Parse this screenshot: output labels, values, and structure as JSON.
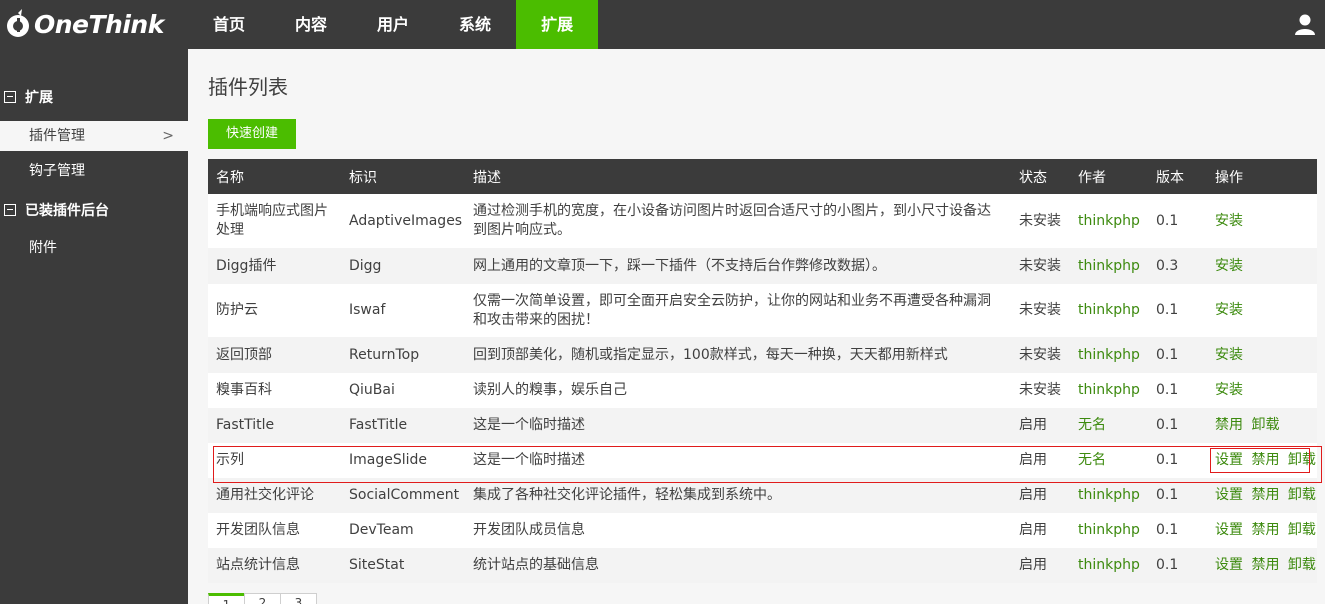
{
  "brand": {
    "name": "OneThink"
  },
  "topnav": [
    {
      "label": "首页",
      "active": false
    },
    {
      "label": "内容",
      "active": false
    },
    {
      "label": "用户",
      "active": false
    },
    {
      "label": "系统",
      "active": false
    },
    {
      "label": "扩展",
      "active": true
    }
  ],
  "sidebar": {
    "group1": {
      "label": "扩展"
    },
    "items1": [
      {
        "label": "插件管理",
        "active": true
      },
      {
        "label": "钩子管理",
        "active": false
      }
    ],
    "group2": {
      "label": "已装插件后台"
    },
    "items2": [
      {
        "label": "附件"
      }
    ]
  },
  "page": {
    "title": "插件列表",
    "create_button": "快速创建"
  },
  "table": {
    "headers": {
      "name": "名称",
      "id": "标识",
      "desc": "描述",
      "status": "状态",
      "author": "作者",
      "version": "版本",
      "ops": "操作"
    },
    "rows": [
      {
        "name": "手机端响应式图片处理",
        "id": "AdaptiveImages",
        "desc": "通过检测手机的宽度，在小设备访问图片时返回合适尺寸的小图片，到小尺寸设备达到图片响应式。",
        "status": "未安装",
        "author": "thinkphp",
        "version": "0.1",
        "ops": [
          "安装"
        ]
      },
      {
        "name": "Digg插件",
        "id": "Digg",
        "desc": "网上通用的文章顶一下，踩一下插件（不支持后台作弊修改数据）。",
        "status": "未安装",
        "author": "thinkphp",
        "version": "0.3",
        "ops": [
          "安装"
        ]
      },
      {
        "name": "防护云",
        "id": "Iswaf",
        "desc": "仅需一次简单设置，即可全面开启安全云防护，让你的网站和业务不再遭受各种漏洞和攻击带来的困扰！",
        "status": "未安装",
        "author": "thinkphp",
        "version": "0.1",
        "ops": [
          "安装"
        ]
      },
      {
        "name": "返回顶部",
        "id": "ReturnTop",
        "desc": "回到顶部美化，随机或指定显示，100款样式，每天一种换，天天都用新样式",
        "status": "未安装",
        "author": "thinkphp",
        "version": "0.1",
        "ops": [
          "安装"
        ]
      },
      {
        "name": "糗事百科",
        "id": "QiuBai",
        "desc": "读别人的糗事，娱乐自己",
        "status": "未安装",
        "author": "thinkphp",
        "version": "0.1",
        "ops": [
          "安装"
        ]
      },
      {
        "name": "FastTitle",
        "id": "FastTitle",
        "desc": "这是一个临时描述",
        "status": "启用",
        "author": "无名",
        "version": "0.1",
        "ops": [
          "禁用",
          "卸载"
        ]
      },
      {
        "name": "示列",
        "id": "ImageSlide",
        "desc": "这是一个临时描述",
        "status": "启用",
        "author": "无名",
        "version": "0.1",
        "ops": [
          "设置",
          "禁用",
          "卸载"
        ]
      },
      {
        "name": "通用社交化评论",
        "id": "SocialComment",
        "desc": "集成了各种社交化评论插件，轻松集成到系统中。",
        "status": "启用",
        "author": "thinkphp",
        "version": "0.1",
        "ops": [
          "设置",
          "禁用",
          "卸载"
        ]
      },
      {
        "name": "开发团队信息",
        "id": "DevTeam",
        "desc": "开发团队成员信息",
        "status": "启用",
        "author": "thinkphp",
        "version": "0.1",
        "ops": [
          "设置",
          "禁用",
          "卸载"
        ]
      },
      {
        "name": "站点统计信息",
        "id": "SiteStat",
        "desc": "统计站点的基础信息",
        "status": "启用",
        "author": "thinkphp",
        "version": "0.1",
        "ops": [
          "设置",
          "禁用",
          "卸载"
        ]
      }
    ]
  },
  "pager": [
    "1",
    "2",
    "3"
  ],
  "colors": {
    "accent": "#4bbd00",
    "dark": "#3b3b3b",
    "link": "#3c8a0e",
    "highlight": "#e01b1b"
  }
}
